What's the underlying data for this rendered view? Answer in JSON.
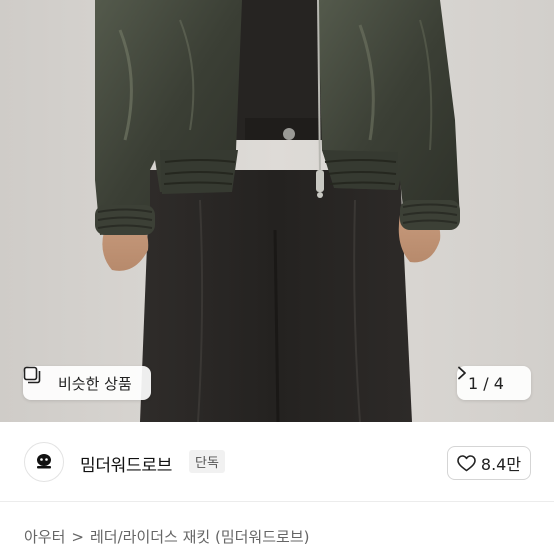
{
  "gallery": {
    "similar_label": "비슷한 상품",
    "pager_text": "1 / 4",
    "current_index": 1,
    "total": 4
  },
  "store": {
    "name": "밈더워드로브",
    "tag": "단독",
    "likes": "8.4만"
  },
  "breadcrumb": {
    "category": "아우터",
    "separator": ">",
    "subcategory": "레더/라이더스 재킷 (밈더워드로브)"
  },
  "icons": {
    "similar": "similar-items-icon",
    "next": "chevron-right-icon",
    "like": "heart-icon",
    "logo": "store-logo"
  },
  "colors": {
    "jacket": "#3f4238",
    "pants": "#2a2826",
    "background": "#d9d6d2",
    "tag_bg": "#f1f1f1"
  }
}
